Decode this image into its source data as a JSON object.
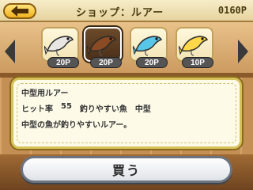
{
  "header": {
    "title": "ショップ：ルアー",
    "money": "0160P"
  },
  "lures": [
    {
      "price": "20P",
      "color": "#e8e6e3",
      "selected": false
    },
    {
      "price": "20P",
      "color": "#8a4a22",
      "selected": true
    },
    {
      "price": "20P",
      "color": "#58c6e8",
      "selected": false
    },
    {
      "price": "10P",
      "color": "#ffd84a",
      "selected": false
    }
  ],
  "info": {
    "name": "中型用ルアー",
    "stats": {
      "hit_rate_label": "ヒット率",
      "hit_rate_value": "55",
      "easy_fish_label": "釣りやすい魚",
      "easy_fish_value": "中型"
    },
    "description": "中型の魚が釣りやすいルアー。"
  },
  "buy_button": {
    "label": "買う"
  },
  "colors": {
    "accent": "#f0b21e",
    "panel_border": "#d6c15a"
  }
}
